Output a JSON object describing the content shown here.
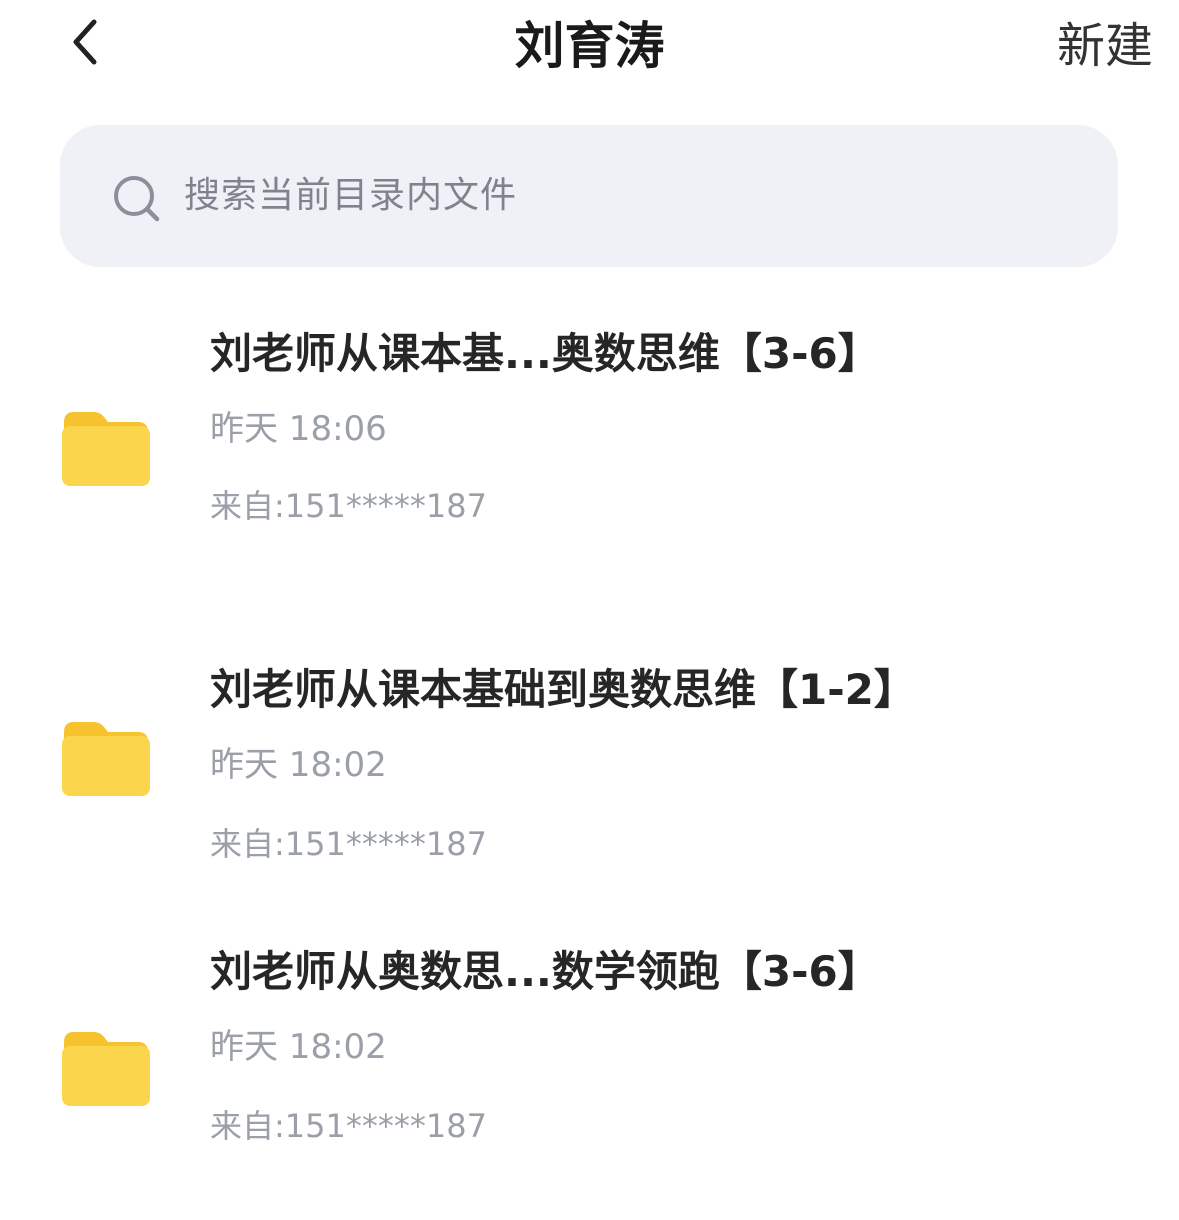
{
  "header": {
    "title": "刘育涛",
    "new_label": "新建",
    "back_icon": "chevron-left-icon"
  },
  "search": {
    "placeholder": "搜索当前目录内文件",
    "icon": "search-icon"
  },
  "files": [
    {
      "name": "刘老师从课本基...奥数思维【3-6】",
      "time": "昨天 18:06",
      "source": "来自:151*****187",
      "icon": "folder-icon"
    },
    {
      "name": "刘老师从课本基础到奥数思维【1-2】",
      "time": "昨天 18:02",
      "source": "来自:151*****187",
      "icon": "folder-icon"
    },
    {
      "name": "刘老师从奥数思...数学领跑【3-6】",
      "time": "昨天 18:02",
      "source": "来自:151*****187",
      "icon": "folder-icon"
    }
  ],
  "colors": {
    "folder": "#f9cd3c",
    "search_bg": "#eff1f6",
    "secondary_text": "#9a9fa8"
  }
}
